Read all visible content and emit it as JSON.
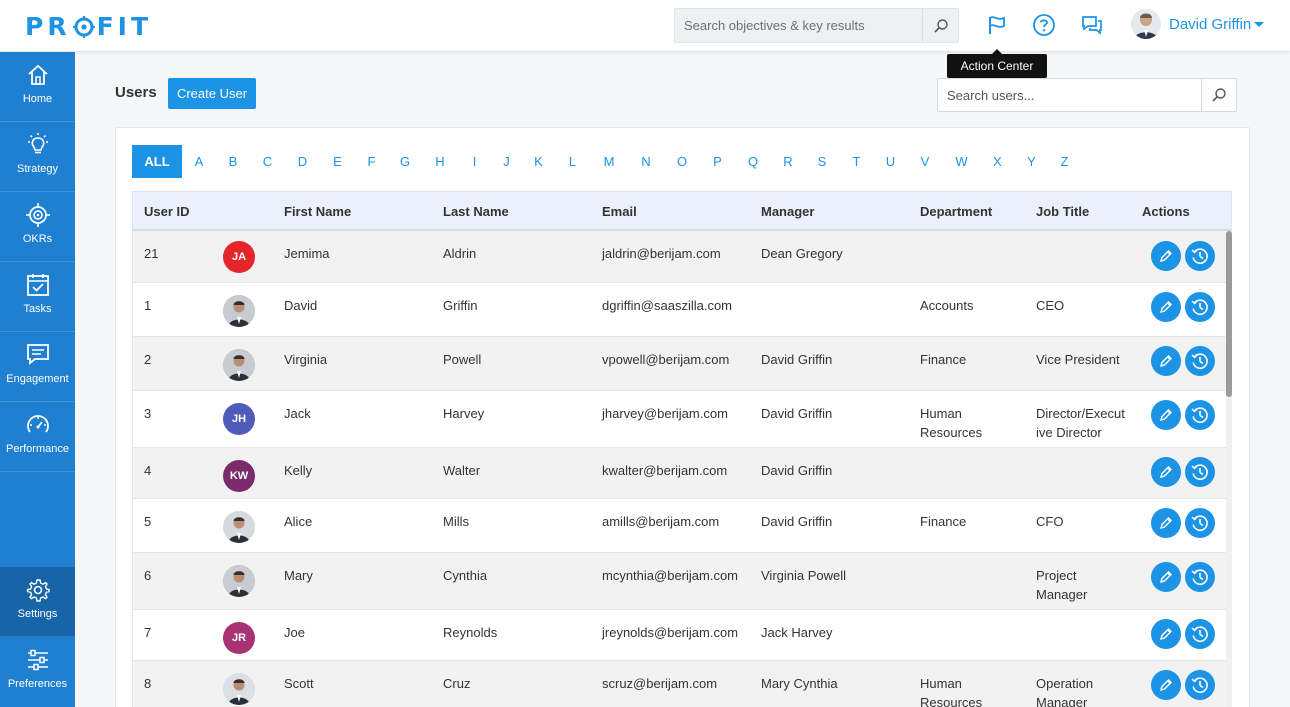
{
  "app": {
    "logo_left": "PR",
    "logo_right": "FIT",
    "search_placeholder": "Search objectives & key results",
    "user_name": "David Griffin",
    "tooltip": "Action Center"
  },
  "colors": {
    "brand": "#1d93e6",
    "sidebar": "#1f7fd1",
    "sidebar_active": "#1764a8"
  },
  "nav": [
    {
      "label": "Home",
      "icon": "home-icon"
    },
    {
      "label": "Strategy",
      "icon": "lightbulb-icon"
    },
    {
      "label": "OKRs",
      "icon": "target-icon"
    },
    {
      "label": "Tasks",
      "icon": "calendar-check-icon"
    },
    {
      "label": "Engagement",
      "icon": "chat-icon"
    },
    {
      "label": "Performance",
      "icon": "speedometer-icon"
    },
    {
      "label": "Settings",
      "icon": "gear-icon"
    },
    {
      "label": "Preferences",
      "icon": "sliders-icon"
    }
  ],
  "page": {
    "title": "Users",
    "create_button": "Create User",
    "search_placeholder": "Search users..."
  },
  "alphabet": [
    "ALL",
    "A",
    "B",
    "C",
    "D",
    "E",
    "F",
    "G",
    "H",
    "I",
    "J",
    "K",
    "L",
    "M",
    "N",
    "O",
    "P",
    "Q",
    "R",
    "S",
    "T",
    "U",
    "V",
    "W",
    "X",
    "Y",
    "Z"
  ],
  "table": {
    "columns": [
      "User ID",
      "First Name",
      "Last Name",
      "Email",
      "Manager",
      "Department",
      "Job Title",
      "Actions"
    ],
    "rows": [
      {
        "id": "21",
        "initials": "JA",
        "avatar_color": "#e5252a",
        "photo": false,
        "first": "Jemima",
        "last": "Aldrin",
        "email": "jaldrin@berijam.com",
        "manager": "Dean Gregory",
        "department": "",
        "job_title": ""
      },
      {
        "id": "1",
        "initials": "",
        "avatar_color": "#c8ccd2",
        "photo": true,
        "first": "David",
        "last": "Griffin",
        "email": "dgriffin@saaszilla.com",
        "manager": "",
        "department": "Accounts",
        "job_title": "CEO"
      },
      {
        "id": "2",
        "initials": "",
        "avatar_color": "#c8ccd2",
        "photo": true,
        "first": "Virginia",
        "last": "Powell",
        "email": "vpowell@berijam.com",
        "manager": "David Griffin",
        "department": "Finance",
        "job_title": "Vice President"
      },
      {
        "id": "3",
        "initials": "JH",
        "avatar_color": "#4f5bb8",
        "photo": false,
        "first": "Jack",
        "last": "Harvey",
        "email": "jharvey@berijam.com",
        "manager": "David Griffin",
        "department": "Human Resources",
        "job_title": "Director/Executive Director"
      },
      {
        "id": "4",
        "initials": "KW",
        "avatar_color": "#7b2b6c",
        "photo": false,
        "first": "Kelly",
        "last": "Walter",
        "email": "kwalter@berijam.com",
        "manager": "David Griffin",
        "department": "",
        "job_title": ""
      },
      {
        "id": "5",
        "initials": "",
        "avatar_color": "#d6d9de",
        "photo": true,
        "first": "Alice",
        "last": "Mills",
        "email": "amills@berijam.com",
        "manager": "David Griffin",
        "department": "Finance",
        "job_title": "CFO"
      },
      {
        "id": "6",
        "initials": "",
        "avatar_color": "#c9cdd3",
        "photo": true,
        "first": "Mary",
        "last": "Cynthia",
        "email": "mcynthia@berijam.com",
        "manager": "Virginia Powell",
        "department": "",
        "job_title": "Project Manager"
      },
      {
        "id": "7",
        "initials": "JR",
        "avatar_color": "#a83273",
        "photo": false,
        "first": "Joe",
        "last": "Reynolds",
        "email": "jreynolds@berijam.com",
        "manager": "Jack Harvey",
        "department": "",
        "job_title": ""
      },
      {
        "id": "8",
        "initials": "",
        "avatar_color": "#dcdfe3",
        "photo": true,
        "first": "Scott",
        "last": "Cruz",
        "email": "scruz@berijam.com",
        "manager": "Mary Cynthia",
        "department": "Human Resources",
        "job_title": "Operation Manager"
      }
    ]
  }
}
